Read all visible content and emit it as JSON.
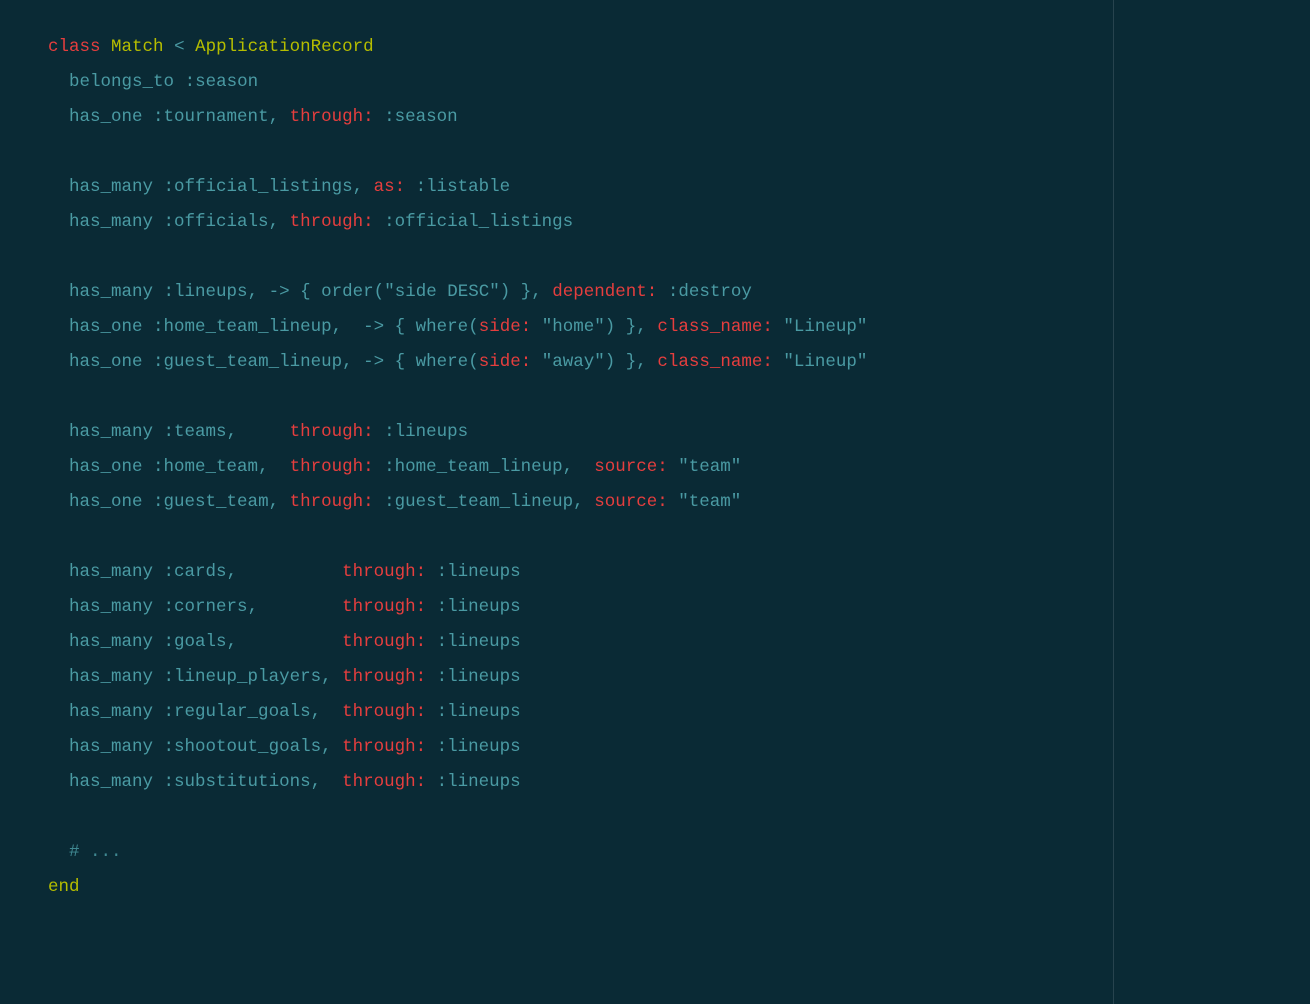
{
  "tokens": {
    "class_kw": "class",
    "class_name": "Match",
    "inherit": "<",
    "parent_class": "ApplicationRecord",
    "belongs_to": "belongs_to",
    "has_one": "has_one",
    "has_many": "has_many",
    "season_sym": ":season",
    "tournament_sym": ":tournament",
    "through_kw": "through:",
    "as_kw": "as:",
    "dependent_kw": "dependent:",
    "class_name_kw": "class_name:",
    "source_kw": "source:",
    "side_kw": "side:",
    "official_listings_sym": ":official_listings",
    "listable_sym": ":listable",
    "officials_sym": ":officials",
    "lineups_sym": ":lineups",
    "destroy_sym": ":destroy",
    "home_team_lineup_sym": ":home_team_lineup",
    "guest_team_lineup_sym": ":guest_team_lineup",
    "teams_sym": ":teams",
    "home_team_sym": ":home_team",
    "guest_team_sym": ":guest_team",
    "cards_sym": ":cards",
    "corners_sym": ":corners",
    "goals_sym": ":goals",
    "lineup_players_sym": ":lineup_players",
    "regular_goals_sym": ":regular_goals",
    "shootout_goals_sym": ":shootout_goals",
    "substitutions_sym": ":substitutions",
    "arrow": "->",
    "order_call": "order",
    "where_call": "where",
    "side_desc_str": "\"side DESC\"",
    "home_str": "\"home\"",
    "away_str": "\"away\"",
    "lineup_str": "\"Lineup\"",
    "team_str": "\"team\"",
    "comment": "# ...",
    "end_kw": "end"
  }
}
